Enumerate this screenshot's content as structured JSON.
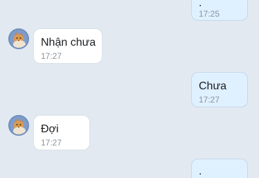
{
  "messages": [
    {
      "direction": "out",
      "text": ".",
      "time": "17:25"
    },
    {
      "direction": "in",
      "text": "Nhận chưa",
      "time": "17:27"
    },
    {
      "direction": "out",
      "text": "Chưa",
      "time": "17:27"
    },
    {
      "direction": "in",
      "text": "Đợi",
      "time": "17:27"
    },
    {
      "direction": "out",
      "text": ".",
      "time": ""
    }
  ],
  "avatar_icon": "cat-avatar-icon",
  "colors": {
    "background": "#e2e9f1",
    "incoming_bubble": "#ffffff",
    "outgoing_bubble": "#dff0ff"
  }
}
